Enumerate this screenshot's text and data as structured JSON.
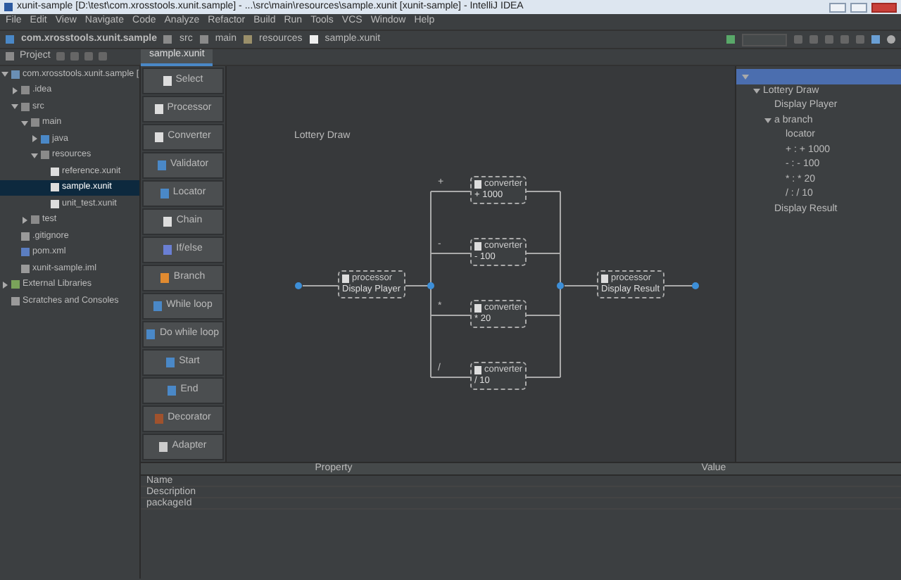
{
  "window": {
    "title": "xunit-sample [D:\\test\\com.xrosstools.xunit.sample] - ...\\src\\main\\resources\\sample.xunit [xunit-sample] - IntelliJ IDEA"
  },
  "menu": [
    "File",
    "Edit",
    "View",
    "Navigate",
    "Code",
    "Analyze",
    "Refactor",
    "Build",
    "Run",
    "Tools",
    "VCS",
    "Window",
    "Help"
  ],
  "breadcrumb": [
    "com.xrosstools.xunit.sample",
    "src",
    "main",
    "resources",
    "sample.xunit"
  ],
  "project_panel": {
    "label": "Project"
  },
  "editor_tabs": [
    {
      "label": "sample.xunit",
      "selected": true
    }
  ],
  "project_tree": [
    {
      "label": "com.xrosstools.xunit.sample [",
      "kind": "module",
      "expanded": true,
      "selected": false,
      "children": [
        {
          "label": ".idea",
          "kind": "folder",
          "expanded": false,
          "selected": false
        },
        {
          "label": "src",
          "kind": "folder",
          "expanded": true,
          "selected": false,
          "children": [
            {
              "label": "main",
              "kind": "folder",
              "expanded": true,
              "selected": false,
              "children": [
                {
                  "label": "java",
                  "kind": "source",
                  "expanded": false,
                  "selected": false
                },
                {
                  "label": "resources",
                  "kind": "folder",
                  "expanded": true,
                  "selected": false,
                  "children": [
                    {
                      "label": "reference.xunit",
                      "kind": "xunit",
                      "selected": false
                    },
                    {
                      "label": "sample.xunit",
                      "kind": "xunit",
                      "selected": true
                    },
                    {
                      "label": "unit_test.xunit",
                      "kind": "xunit",
                      "selected": false
                    }
                  ]
                }
              ]
            },
            {
              "label": "test",
              "kind": "folder",
              "expanded": false,
              "selected": false
            }
          ]
        },
        {
          "label": ".gitignore",
          "kind": "file",
          "selected": false
        },
        {
          "label": "pom.xml",
          "kind": "maven",
          "selected": false
        },
        {
          "label": "xunit-sample.iml",
          "kind": "file",
          "selected": false
        }
      ]
    },
    {
      "label": "External Libraries",
      "kind": "library",
      "expanded": false,
      "selected": false
    },
    {
      "label": "Scratches and Consoles",
      "kind": "scratch",
      "selected": false
    }
  ],
  "palette": [
    {
      "label": "Select",
      "kind": "select"
    },
    {
      "label": "Processor",
      "kind": "doc"
    },
    {
      "label": "Converter",
      "kind": "doc"
    },
    {
      "label": "Validator",
      "kind": "validator"
    },
    {
      "label": "Locator",
      "kind": "locator"
    },
    {
      "label": "Chain",
      "kind": "chain"
    },
    {
      "label": "If/else",
      "kind": "ifelse"
    },
    {
      "label": "Branch",
      "kind": "branch"
    },
    {
      "label": "While loop",
      "kind": "loop"
    },
    {
      "label": "Do while loop",
      "kind": "loop"
    },
    {
      "label": "Start",
      "kind": "start"
    },
    {
      "label": "End",
      "kind": "end"
    },
    {
      "label": "Decorator",
      "kind": "decorator"
    },
    {
      "label": "Adapter",
      "kind": "adapter"
    }
  ],
  "diagram": {
    "title": "Lottery Draw",
    "first": {
      "type": "processor",
      "name": "Display Player"
    },
    "branches": [
      {
        "key": "+",
        "node": {
          "type": "converter",
          "name": "+ 1000"
        }
      },
      {
        "key": "-",
        "node": {
          "type": "converter",
          "name": "- 100"
        }
      },
      {
        "key": "*",
        "node": {
          "type": "converter",
          "name": "* 20"
        }
      },
      {
        "key": "/",
        "node": {
          "type": "converter",
          "name": "/ 10"
        }
      }
    ],
    "last": {
      "type": "processor",
      "name": "Display Result"
    }
  },
  "outline": [
    {
      "selected": true,
      "children": [
        {
          "label": "Lottery Draw",
          "selected": false,
          "children": [
            {
              "label": "Display Player",
              "selected": false
            },
            {
              "label": "a branch",
              "selected": false,
              "children": [
                {
                  "label": "locator",
                  "selected": false
                },
                {
                  "label": "+ : + 1000",
                  "selected": false
                },
                {
                  "label": "- : - 100",
                  "selected": false
                },
                {
                  "label": "* : * 20",
                  "selected": false
                },
                {
                  "label": "/ : / 10",
                  "selected": false
                }
              ]
            },
            {
              "label": "Display Result",
              "selected": false
            }
          ]
        }
      ]
    }
  ],
  "properties": {
    "columns": [
      "Property",
      "Value"
    ],
    "rows": [
      "Name",
      "Description",
      "packageId"
    ]
  }
}
